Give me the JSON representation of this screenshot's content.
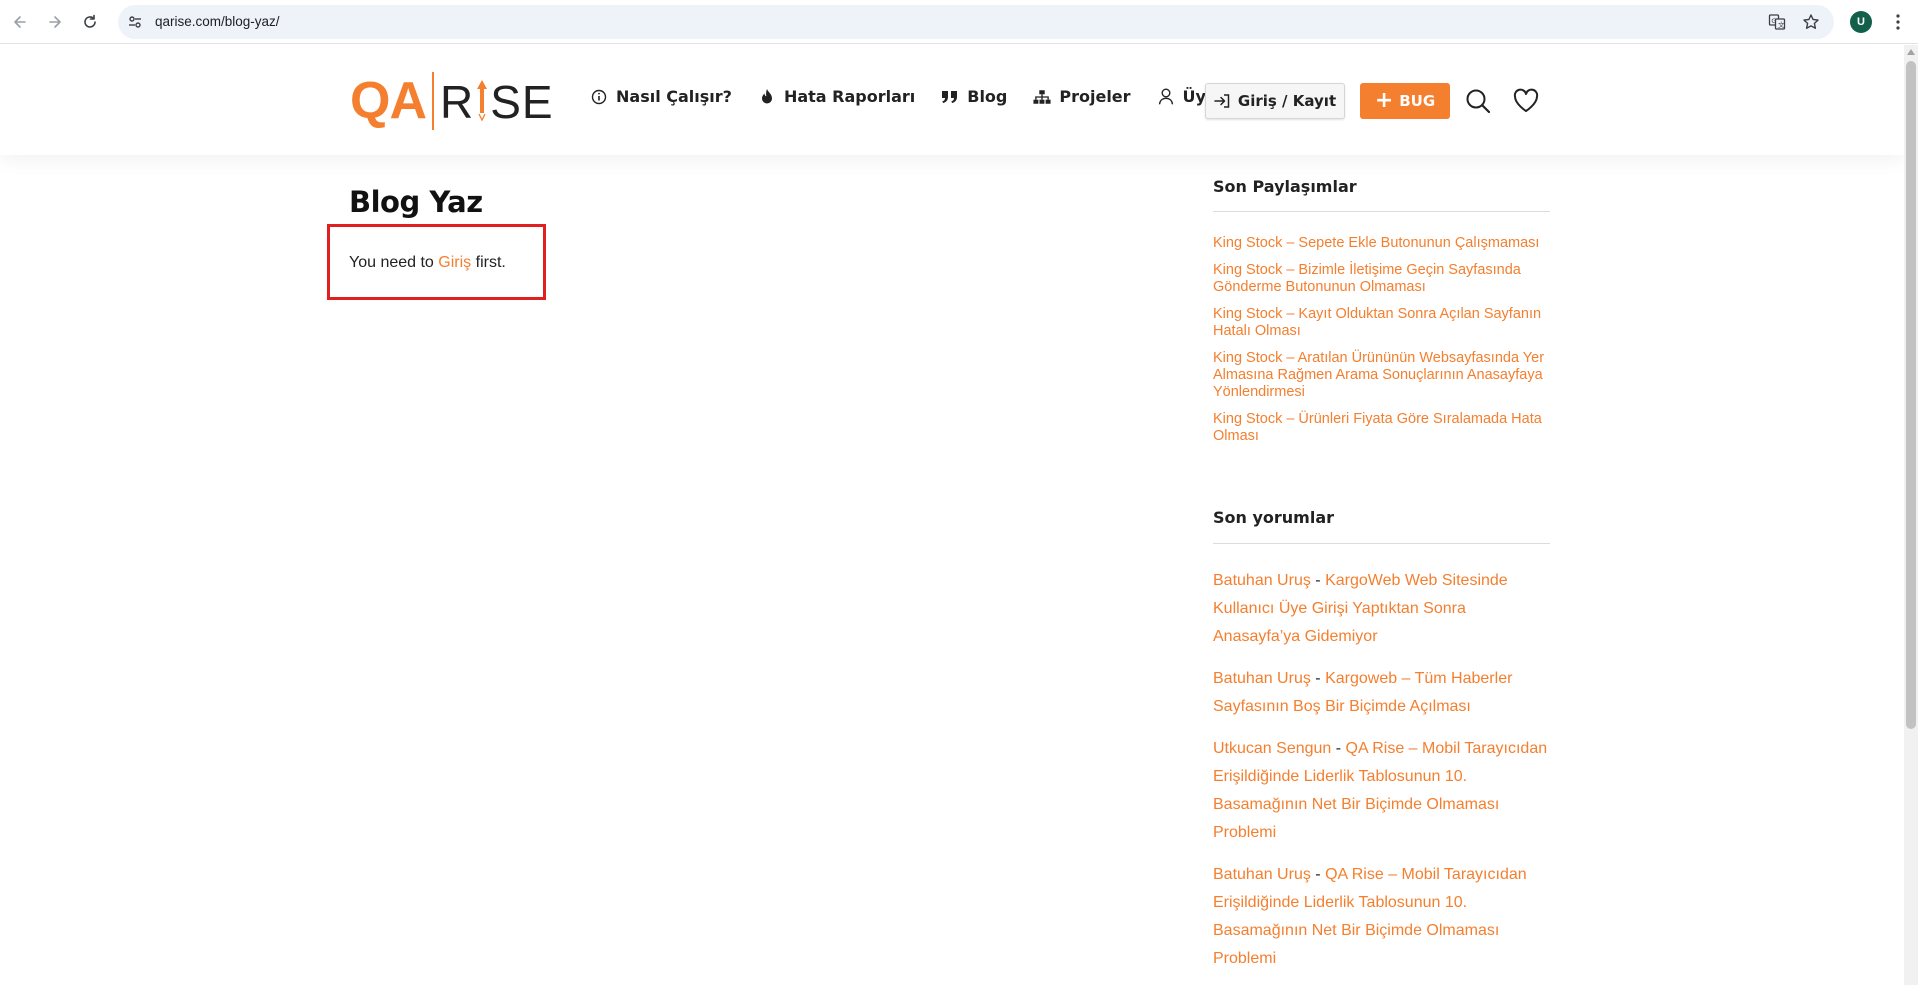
{
  "browser": {
    "url": "qarise.com/blog-yaz/",
    "profile_initial": "U"
  },
  "site": {
    "logo_left": "QA",
    "logo_right": "RISE",
    "logo_right_pre": "R",
    "logo_right_post": "SE",
    "brand_color": "#f47f2e",
    "menu": [
      {
        "label": "Nasıl Çalışır?",
        "icon": "info-icon"
      },
      {
        "label": "Hata Raporları",
        "icon": "fire-icon"
      },
      {
        "label": "Blog",
        "icon": "quote-icon"
      },
      {
        "label": "Projeler",
        "icon": "sitemap-icon"
      },
      {
        "label": "Üyeler",
        "icon": "user-icon"
      }
    ],
    "login_label": "Giriş / Kayıt",
    "bug_label": "BUG"
  },
  "main": {
    "title": "Blog Yaz",
    "notice_pre": "You need to ",
    "notice_link": "Giriş",
    "notice_post": " first."
  },
  "sidebar": {
    "recent_title": "Son Paylaşımlar",
    "recent": [
      "King Stock – Sepete Ekle Butonunun Çalışmaması",
      "King Stock – Bizimle İletişime Geçin Sayfasında Gönderme Butonunun Olmaması",
      "King Stock – Kayıt Olduktan Sonra Açılan Sayfanın Hatalı Olması",
      "King Stock – Aratılan Ürününün Websayfasında Yer Almasına Rağmen Arama Sonuçlarının Anasayfaya Yönlendirmesi",
      "King Stock – Ürünleri Fiyata Göre Sıralamada Hata Olması"
    ],
    "comments_title": "Son yorumlar",
    "comments": [
      {
        "author": "Batuhan Uruş",
        "sep": " - ",
        "post": "KargoWeb Web Sitesinde Kullanıcı Üye Girişi Yaptıktan Sonra Anasayfa’ya Gidemiyor"
      },
      {
        "author": "Batuhan Uruş",
        "sep": " - ",
        "post": "Kargoweb – Tüm Haberler Sayfasının Boş Bir Biçimde Açılması"
      },
      {
        "author": "Utkucan Sengun",
        "sep": " - ",
        "post": "QA Rise – Mobil Tarayıcıdan Erişildiğinde Liderlik Tablosunun 10. Basamağının Net Bir Biçimde Olmaması Problemi"
      },
      {
        "author": "Batuhan Uruş",
        "sep": " - ",
        "post": "QA Rise – Mobil Tarayıcıdan Erişildiğinde Liderlik Tablosunun 10. Basamağının Net Bir Biçimde Olmaması Problemi"
      }
    ]
  }
}
